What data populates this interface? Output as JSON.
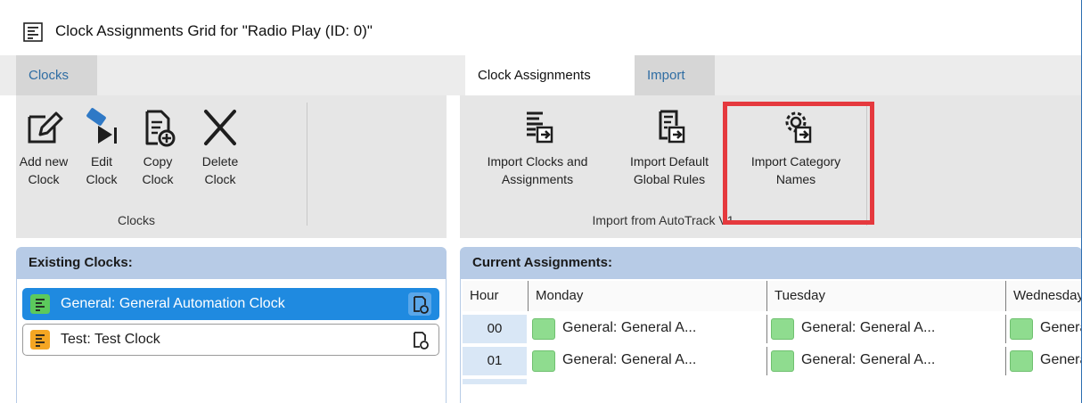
{
  "window": {
    "title": "Clock Assignments Grid for \"Radio Play (ID: 0)\""
  },
  "tabs_left": [
    {
      "label": "Clocks"
    }
  ],
  "tabs_right": [
    {
      "label": "Clock Assignments"
    },
    {
      "label": "Import"
    }
  ],
  "ribbon_left": {
    "buttons": [
      {
        "label": "Add new\nClock",
        "icon": "edit-new-icon"
      },
      {
        "label": "Edit\nClock",
        "icon": "pen-edit-icon"
      },
      {
        "label": "Copy\nClock",
        "icon": "copy-doc-icon"
      },
      {
        "label": "Delete\nClock",
        "icon": "x-delete-icon"
      }
    ],
    "group_label": "Clocks"
  },
  "ribbon_right": {
    "buttons": [
      {
        "label": "Import Clocks and\nAssignments",
        "icon": "import-list-icon"
      },
      {
        "label": "Import Default\nGlobal Rules",
        "icon": "import-rules-icon"
      },
      {
        "label": "Import Category\nNames",
        "icon": "import-gear-icon"
      }
    ],
    "group_label": "Import from AutoTrack V1"
  },
  "existing_clocks": {
    "header": "Existing Clocks:",
    "items": [
      {
        "name": "General: General Automation Clock",
        "color": "#5cc95c",
        "selected": true
      },
      {
        "name": "Test: Test Clock",
        "color": "#f5a623",
        "selected": false
      }
    ]
  },
  "current_assignments": {
    "header": "Current Assignments:",
    "columns": [
      "Hour",
      "Monday",
      "Tuesday",
      "Wednesday"
    ],
    "rows": [
      {
        "hour": "00",
        "cells": [
          "General: General A...",
          "General: General A...",
          "General: General A..."
        ]
      },
      {
        "hour": "01",
        "cells": [
          "General: General A...",
          "General: General A...",
          "General: General A..."
        ]
      }
    ]
  },
  "colors": {
    "accent": "#1f8ae0",
    "highlight": "#e5393e",
    "assign": "#8fdc8f"
  }
}
